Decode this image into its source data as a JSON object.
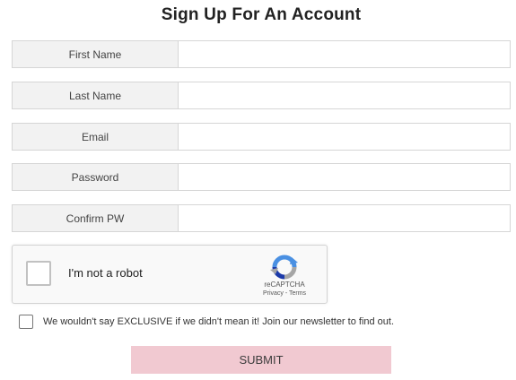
{
  "form": {
    "title": "Sign Up For An Account",
    "fields": [
      {
        "label": "First Name",
        "value": "",
        "placeholder": ""
      },
      {
        "label": "Last Name",
        "value": "",
        "placeholder": ""
      },
      {
        "label": "Email",
        "value": "",
        "placeholder": ""
      },
      {
        "label": "Password",
        "value": "",
        "placeholder": ""
      },
      {
        "label": "Confirm PW",
        "value": "",
        "placeholder": ""
      }
    ],
    "recaptcha": {
      "label": "I'm not a robot",
      "brand": "reCAPTCHA",
      "privacy": "Privacy",
      "separator": " - ",
      "terms": "Terms",
      "icon": "recaptcha-logo-icon"
    },
    "newsletter": {
      "text": "We wouldn't say EXCLUSIVE if we didn't mean it! Join our newsletter to find out."
    },
    "submit_label": "SUBMIT"
  },
  "colors": {
    "label_bg": "#f2f2f2",
    "border": "#d6d6d6",
    "submit_bg": "#f1c9d1",
    "recaptcha_blue": "#4a90e2",
    "recaptcha_gray": "#a6a6a6"
  }
}
